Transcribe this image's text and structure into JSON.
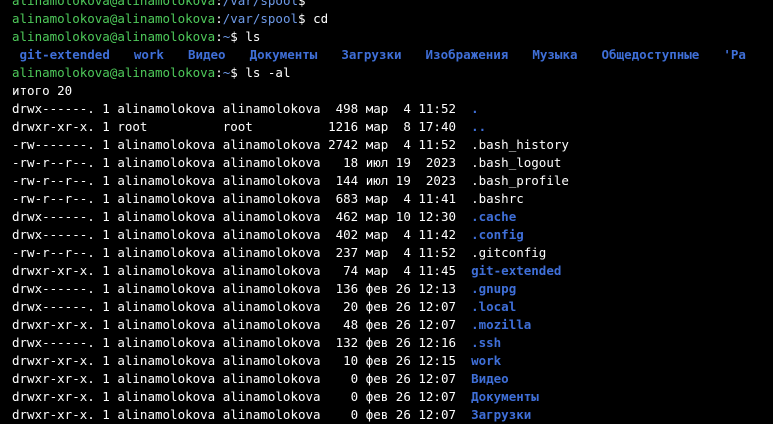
{
  "colors": {
    "background": "#000000",
    "prompt_user": "#4ec95a",
    "prompt_path": "#6e9ae8",
    "directory": "#3f6fd8",
    "text": "#ffffff"
  },
  "prompts": [
    {
      "user": "alinamolokova@alinamolokova",
      "path": "/var/spool",
      "symbol": "$",
      "command": ""
    },
    {
      "user": "alinamolokova@alinamolokova",
      "path": "/var/spool",
      "symbol": "$",
      "command": "cd"
    },
    {
      "user": "alinamolokova@alinamolokova",
      "path": "~",
      "symbol": "$",
      "command": "ls"
    },
    {
      "user": "alinamolokova@alinamolokova",
      "path": "~",
      "symbol": "$",
      "command": "ls -al"
    }
  ],
  "ls_output": [
    "git-extended",
    "work",
    "Видео",
    "Документы",
    "Загрузки",
    "Изображения",
    "Музыка",
    "Общедоступные",
    "'Ра"
  ],
  "total_line": "итого 20",
  "listing": [
    {
      "perms": "drwx------.",
      "links": "1",
      "owner": "alinamolokova",
      "group": "alinamolokova",
      "size": "498",
      "month": "мар",
      "day": "4",
      "time": "11:52",
      "name": ".",
      "is_dir": true
    },
    {
      "perms": "drwxr-xr-x.",
      "links": "1",
      "owner": "root",
      "group": "root",
      "size": "1216",
      "month": "мар",
      "day": "8",
      "time": "17:40",
      "name": "..",
      "is_dir": true
    },
    {
      "perms": "-rw-------.",
      "links": "1",
      "owner": "alinamolokova",
      "group": "alinamolokova",
      "size": "2742",
      "month": "мар",
      "day": "4",
      "time": "11:52",
      "name": ".bash_history",
      "is_dir": false
    },
    {
      "perms": "-rw-r--r--.",
      "links": "1",
      "owner": "alinamolokova",
      "group": "alinamolokova",
      "size": "18",
      "month": "июл",
      "day": "19",
      "time": "2023",
      "name": ".bash_logout",
      "is_dir": false
    },
    {
      "perms": "-rw-r--r--.",
      "links": "1",
      "owner": "alinamolokova",
      "group": "alinamolokova",
      "size": "144",
      "month": "июл",
      "day": "19",
      "time": "2023",
      "name": ".bash_profile",
      "is_dir": false
    },
    {
      "perms": "-rw-r--r--.",
      "links": "1",
      "owner": "alinamolokova",
      "group": "alinamolokova",
      "size": "683",
      "month": "мар",
      "day": "4",
      "time": "11:41",
      "name": ".bashrc",
      "is_dir": false
    },
    {
      "perms": "drwx------.",
      "links": "1",
      "owner": "alinamolokova",
      "group": "alinamolokova",
      "size": "462",
      "month": "мар",
      "day": "10",
      "time": "12:30",
      "name": ".cache",
      "is_dir": true
    },
    {
      "perms": "drwx------.",
      "links": "1",
      "owner": "alinamolokova",
      "group": "alinamolokova",
      "size": "402",
      "month": "мар",
      "day": "4",
      "time": "11:42",
      "name": ".config",
      "is_dir": true
    },
    {
      "perms": "-rw-r--r--.",
      "links": "1",
      "owner": "alinamolokova",
      "group": "alinamolokova",
      "size": "237",
      "month": "мар",
      "day": "4",
      "time": "11:52",
      "name": ".gitconfig",
      "is_dir": false
    },
    {
      "perms": "drwxr-xr-x.",
      "links": "1",
      "owner": "alinamolokova",
      "group": "alinamolokova",
      "size": "74",
      "month": "мар",
      "day": "4",
      "time": "11:45",
      "name": "git-extended",
      "is_dir": true
    },
    {
      "perms": "drwx------.",
      "links": "1",
      "owner": "alinamolokova",
      "group": "alinamolokova",
      "size": "136",
      "month": "фев",
      "day": "26",
      "time": "12:13",
      "name": ".gnupg",
      "is_dir": true
    },
    {
      "perms": "drwx------.",
      "links": "1",
      "owner": "alinamolokova",
      "group": "alinamolokova",
      "size": "20",
      "month": "фев",
      "day": "26",
      "time": "12:07",
      "name": ".local",
      "is_dir": true
    },
    {
      "perms": "drwxr-xr-x.",
      "links": "1",
      "owner": "alinamolokova",
      "group": "alinamolokova",
      "size": "48",
      "month": "фев",
      "day": "26",
      "time": "12:07",
      "name": ".mozilla",
      "is_dir": true
    },
    {
      "perms": "drwx------.",
      "links": "1",
      "owner": "alinamolokova",
      "group": "alinamolokova",
      "size": "132",
      "month": "фев",
      "day": "26",
      "time": "12:16",
      "name": ".ssh",
      "is_dir": true
    },
    {
      "perms": "drwxr-xr-x.",
      "links": "1",
      "owner": "alinamolokova",
      "group": "alinamolokova",
      "size": "10",
      "month": "фев",
      "day": "26",
      "time": "12:15",
      "name": "work",
      "is_dir": true
    },
    {
      "perms": "drwxr-xr-x.",
      "links": "1",
      "owner": "alinamolokova",
      "group": "alinamolokova",
      "size": "0",
      "month": "фев",
      "day": "26",
      "time": "12:07",
      "name": "Видео",
      "is_dir": true
    },
    {
      "perms": "drwxr-xr-x.",
      "links": "1",
      "owner": "alinamolokova",
      "group": "alinamolokova",
      "size": "0",
      "month": "фев",
      "day": "26",
      "time": "12:07",
      "name": "Документы",
      "is_dir": true
    },
    {
      "perms": "drwxr-xr-x.",
      "links": "1",
      "owner": "alinamolokova",
      "group": "alinamolokova",
      "size": "0",
      "month": "фев",
      "day": "26",
      "time": "12:07",
      "name": "Загрузки",
      "is_dir": true
    }
  ]
}
